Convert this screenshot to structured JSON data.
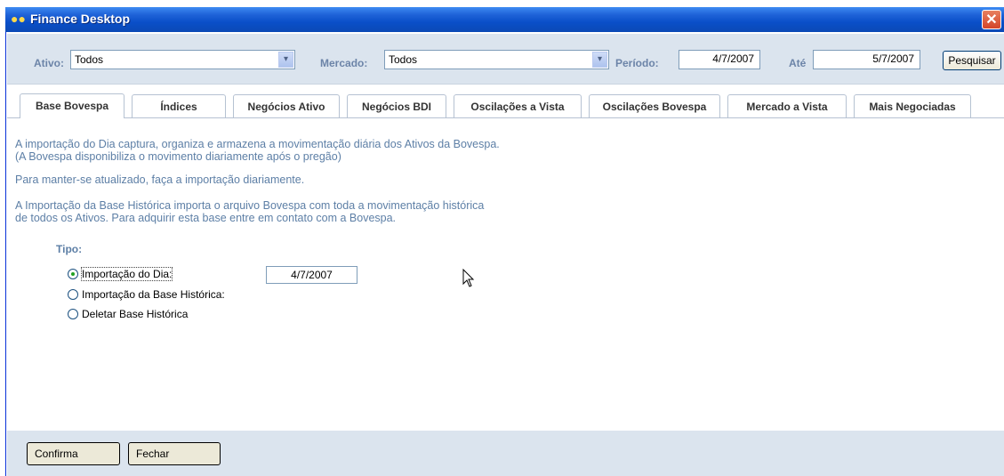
{
  "window": {
    "title": "Finance Desktop",
    "close_glyph": "✕",
    "icon": "users-icon"
  },
  "filters": {
    "ativo_label": "Ativo:",
    "ativo_value": "Todos",
    "mercado_label": "Mercado:",
    "mercado_value": "Todos",
    "periodo_label": "Período:",
    "periodo_from": "4/7/2007",
    "ate_label": "Até",
    "periodo_to": "5/7/2007",
    "search_label": "Pesquisar",
    "dropdown_glyph": "▾"
  },
  "tabs": [
    {
      "label": "Base Bovespa",
      "active": true
    },
    {
      "label": "Índices"
    },
    {
      "label": "Negócios Ativo"
    },
    {
      "label": "Negócios BDI"
    },
    {
      "label": "Oscilações a Vista"
    },
    {
      "label": "Oscilações Bovespa"
    },
    {
      "label": "Mercado a Vista"
    },
    {
      "label": "Mais Negociadas"
    }
  ],
  "content": {
    "para1_line1": "A importação do Dia captura, organiza e armazena a movimentação diária dos Ativos da Bovespa.",
    "para1_line2": "(A Bovespa disponibiliza o movimento diariamente após o pregão)",
    "para2": "Para manter-se atualizado, faça a importação diariamente.",
    "para3_line1": "A Importação da Base Histórica importa o arquivo Bovespa com toda a movimentação histórica",
    "para3_line2": "de todos os Ativos.  Para adquirir esta base entre em contato com a Bovespa.",
    "tipo_label": "Tipo:",
    "options": [
      {
        "label": "Importação do Dia:",
        "selected": true
      },
      {
        "label": "Importação da Base Histórica:",
        "selected": false
      },
      {
        "label": "Deletar Base Histórica",
        "selected": false
      }
    ],
    "import_date": "4/7/2007"
  },
  "footer": {
    "confirm_label": "Confirma",
    "close_label": "Fechar"
  },
  "colors": {
    "title_bar": "#1f63d8",
    "panel_bg": "#dbe4ee",
    "label_blue": "#5d7fa6"
  }
}
